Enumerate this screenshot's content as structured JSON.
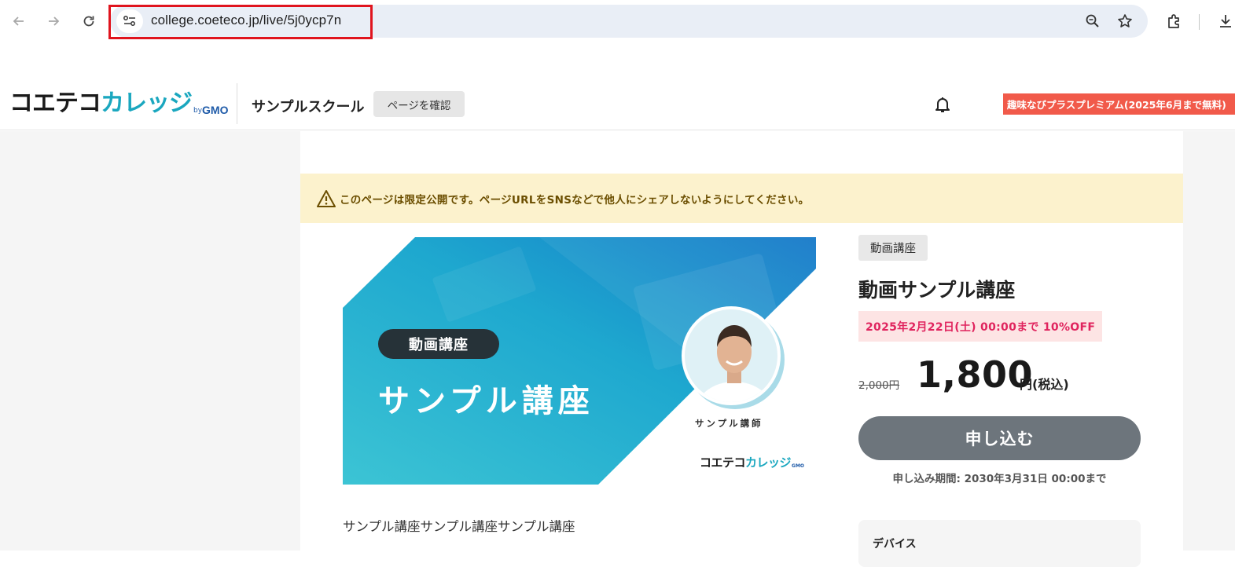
{
  "browser": {
    "url": "college.coeteco.jp/live/5j0ycp7n",
    "icons": [
      "back-arrow-icon",
      "forward-arrow-icon",
      "reload-icon",
      "site-info-icon",
      "zoom-icon",
      "bookmark-star-icon",
      "extensions-icon",
      "download-icon"
    ]
  },
  "header": {
    "logo_main": "コエテコ",
    "logo_accent": "カレッジ",
    "logo_by": "by",
    "logo_gmo": "GMO",
    "school_name": "サンプルスクール",
    "page_confirm_label": "ページを確認",
    "premium_badge": "趣味なびプラスプレミアム(2025年6月まで無料)",
    "accent_color": "#1aa7bf",
    "badge_color": "#f15a4a"
  },
  "notice": {
    "text": "このページは限定公開です。ページURLをSNSなどで他人にシェアしないようにしてください。"
  },
  "banner": {
    "tag": "動画講座",
    "title": "サンプル講座",
    "instructor_label": "サンプル講師",
    "logo_main": "コエテコ",
    "logo_accent": "カレッジ",
    "logo_gmo": "GMO"
  },
  "course": {
    "category": "動画講座",
    "title": "動画サンプル講座",
    "discount": "2025年2月22日(土) 00:00まで 10%OFF",
    "old_price": "2,000円",
    "price": "1,800",
    "price_unit": "円(税込)",
    "apply_label": "申し込む",
    "apply_period": "申し込み期間: 2030年3月31日 00:00まで",
    "description": "サンプル講座サンプル講座サンプル講座",
    "device_label": "デバイス"
  }
}
